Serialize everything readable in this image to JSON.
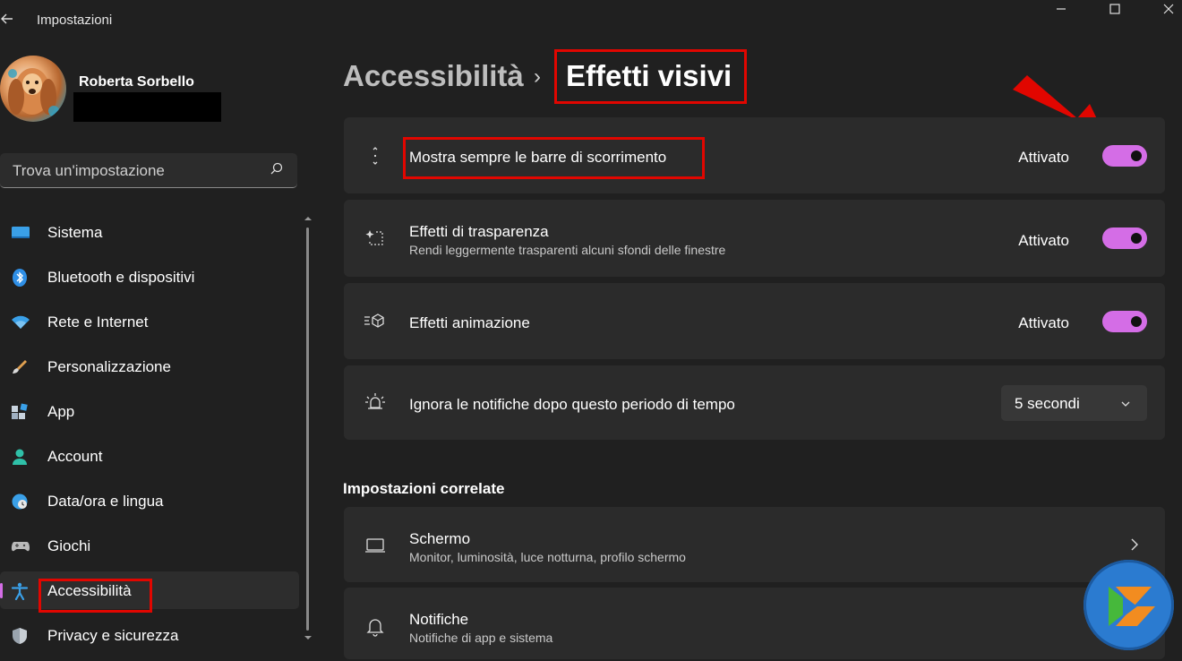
{
  "window": {
    "title": "Impostazioni",
    "controls": [
      "minimize",
      "maximize",
      "close"
    ]
  },
  "profile": {
    "name": "Roberta Sorbello"
  },
  "search": {
    "placeholder": "Trova un'impostazione"
  },
  "nav": {
    "items": [
      {
        "label": "Sistema",
        "icon": "monitor-icon"
      },
      {
        "label": "Bluetooth e dispositivi",
        "icon": "bluetooth-icon"
      },
      {
        "label": "Rete e Internet",
        "icon": "wifi-icon"
      },
      {
        "label": "Personalizzazione",
        "icon": "brush-icon"
      },
      {
        "label": "App",
        "icon": "apps-icon"
      },
      {
        "label": "Account",
        "icon": "person-icon"
      },
      {
        "label": "Data/ora e lingua",
        "icon": "globe-clock-icon"
      },
      {
        "label": "Giochi",
        "icon": "gamepad-icon"
      },
      {
        "label": "Accessibilità",
        "icon": "accessibility-icon",
        "active": true
      },
      {
        "label": "Privacy e sicurezza",
        "icon": "shield-icon"
      }
    ]
  },
  "header": {
    "parent": "Accessibilità",
    "separator": "›",
    "current": "Effetti visivi"
  },
  "settings": [
    {
      "title": "Mostra sempre le barre di scorrimento",
      "state": "Attivato",
      "toggle_on": true,
      "icon": "scroll-arrows-icon"
    },
    {
      "title": "Effetti di trasparenza",
      "subtitle": "Rendi leggermente trasparenti alcuni sfondi delle finestre",
      "state": "Attivato",
      "toggle_on": true,
      "icon": "sparkle-window-icon"
    },
    {
      "title": "Effetti animazione",
      "state": "Attivato",
      "toggle_on": true,
      "icon": "animation-icon"
    },
    {
      "title": "Ignora le notifiche dopo questo periodo di tempo",
      "dropdown_value": "5 secondi",
      "icon": "sun-alert-icon"
    }
  ],
  "related": {
    "title": "Impostazioni correlate",
    "items": [
      {
        "title": "Schermo",
        "subtitle": "Monitor, luminosità, luce notturna, profilo schermo",
        "icon": "laptop-icon"
      },
      {
        "title": "Notifiche",
        "subtitle": "Notifiche di app e sistema",
        "icon": "bell-icon"
      }
    ]
  },
  "colors": {
    "accent": "#d46de6",
    "background": "#202020",
    "card": "#2b2b2b",
    "highlight_box": "#e10600"
  }
}
